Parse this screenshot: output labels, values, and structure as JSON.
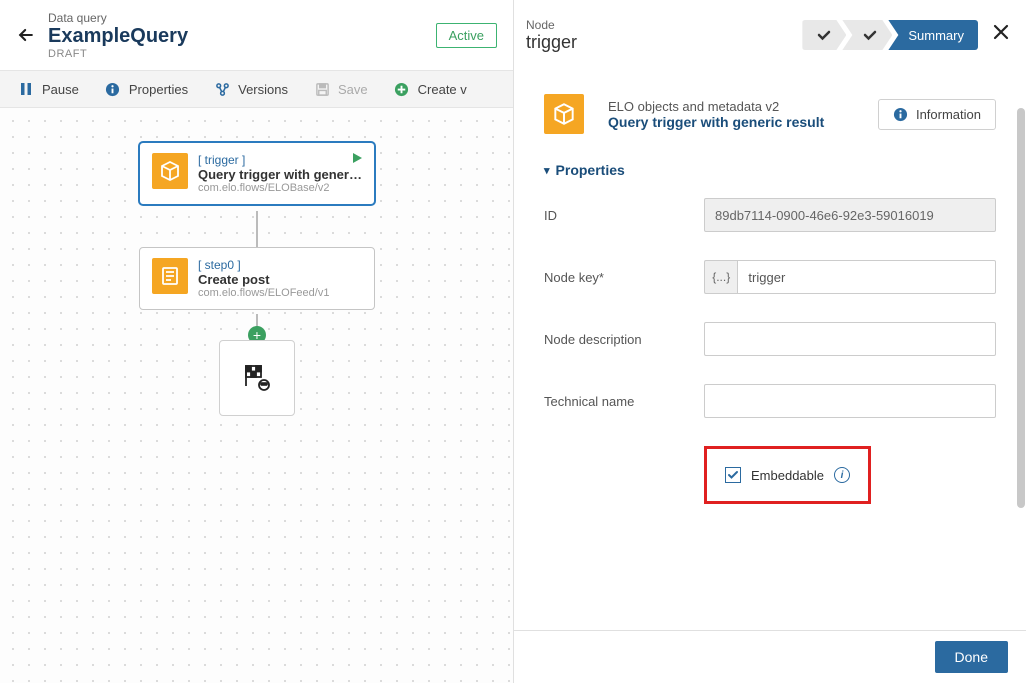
{
  "left": {
    "kicker": "Data query",
    "name": "ExampleQuery",
    "status": "DRAFT",
    "activeBadge": "Active"
  },
  "toolbar": {
    "pause": "Pause",
    "properties": "Properties",
    "versions": "Versions",
    "save": "Save",
    "create": "Create v"
  },
  "canvasNodes": {
    "trigger": {
      "label": "[ trigger ]",
      "title": "Query trigger with generi…",
      "path": "com.elo.flows/ELOBase/v2"
    },
    "step0": {
      "label": "[ step0 ]",
      "title": "Create post",
      "path": "com.elo.flows/ELOFeed/v1"
    }
  },
  "right": {
    "kicker": "Node",
    "name": "trigger",
    "steps": {
      "summary": "Summary"
    },
    "summary": {
      "kicker": "ELO objects and metadata  v2",
      "title": "Query trigger with generic result"
    },
    "infoBtn": "Information",
    "propertiesHeader": "Properties",
    "fields": {
      "idLabel": "ID",
      "idValue": "89db7114-0900-46e6-92e3-59016019",
      "nodeKeyLabel": "Node key*",
      "nodeKeyPrefix": "{...}",
      "nodeKeyValue": "trigger",
      "descLabel": "Node description",
      "descValue": "",
      "techLabel": "Technical name",
      "techValue": "",
      "embeddableLabel": "Embeddable"
    },
    "doneBtn": "Done"
  }
}
